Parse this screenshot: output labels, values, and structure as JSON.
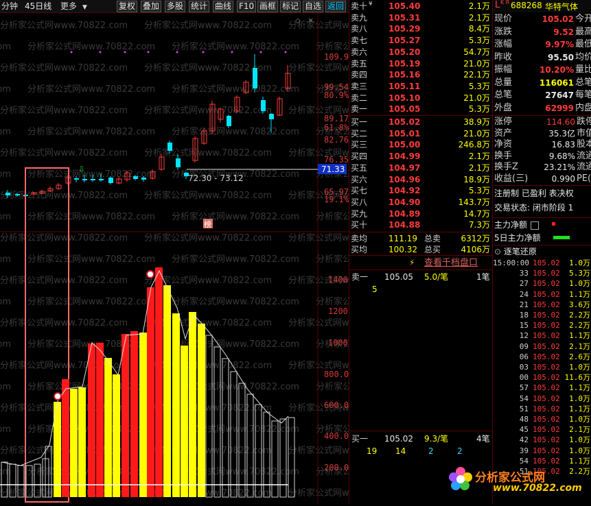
{
  "toolbar": {
    "period_left": "分钟",
    "period": "45日线",
    "more": "更多",
    "buttons": [
      "复权",
      "叠加",
      "多股",
      "统计",
      "曲线",
      "F10",
      "画框",
      "标记",
      "自选",
      "返回"
    ],
    "active": "返回"
  },
  "chart": {
    "price_axis": [
      "109.9",
      "99.54",
      "89.17",
      "82.76",
      "76.35",
      "65.97"
    ],
    "percent_axis": [
      "80.9%",
      "61.8%",
      "19.1%"
    ],
    "range_label": "72.30 - 73.12",
    "price_tag": "71.33",
    "volume_axis": [
      "1400",
      "1200",
      "1000",
      "800.0",
      "600.0",
      "400.0",
      "200.0"
    ],
    "marker_text": "榜",
    "watermark": "分析家公式网www.70822.com"
  },
  "stock": {
    "flag": "L",
    "flag_sup": "K R",
    "code": "688268",
    "name": "华特气体"
  },
  "ask": [
    {
      "label": "卖十",
      "price": "105.40",
      "vol": "2.1万"
    },
    {
      "label": "卖九",
      "price": "105.31",
      "vol": "2.1万"
    },
    {
      "label": "卖八",
      "price": "105.29",
      "vol": "8.4万"
    },
    {
      "label": "卖七",
      "price": "105.27",
      "vol": "5.3万"
    },
    {
      "label": "卖六",
      "price": "105.20",
      "vol": "54.7万"
    },
    {
      "label": "卖五",
      "price": "105.19",
      "vol": "21.0万"
    },
    {
      "label": "卖四",
      "price": "105.16",
      "vol": "22.1万"
    },
    {
      "label": "卖三",
      "price": "105.11",
      "vol": "5.3万"
    },
    {
      "label": "卖二",
      "price": "105.10",
      "vol": "21.0万"
    },
    {
      "label": "卖一",
      "price": "105.05",
      "vol": "5.3万"
    }
  ],
  "ask_sup": "¥",
  "bid": [
    {
      "label": "买一",
      "price": "105.02",
      "vol": "38.9万"
    },
    {
      "label": "买二",
      "price": "105.01",
      "vol": "21.0万"
    },
    {
      "label": "买三",
      "price": "105.00",
      "vol": "246.8万"
    },
    {
      "label": "买四",
      "price": "104.99",
      "vol": "2.1万"
    },
    {
      "label": "买五",
      "price": "104.97",
      "vol": "2.1万"
    },
    {
      "label": "买六",
      "price": "104.96",
      "vol": "18.9万"
    },
    {
      "label": "买七",
      "price": "104.92",
      "vol": "5.3万"
    },
    {
      "label": "买八",
      "price": "104.90",
      "vol": "143.7万"
    },
    {
      "label": "买九",
      "price": "104.89",
      "vol": "14.7万"
    },
    {
      "label": "买十",
      "price": "104.88",
      "vol": "7.3万"
    }
  ],
  "summary": [
    {
      "label": "卖均",
      "price": "111.19",
      "tag": "总卖",
      "vol": "6312万"
    },
    {
      "label": "买均",
      "price": "100.32",
      "tag": "总买",
      "vol": "4106万"
    }
  ],
  "quote": [
    {
      "k": "现价",
      "v": "105.02",
      "k2": "今开"
    },
    {
      "k": "涨跌",
      "v": "9.52",
      "k2": "最高"
    },
    {
      "k": "涨幅",
      "v": "9.97%",
      "k2": "最低"
    },
    {
      "k": "昨收",
      "v": "95.50",
      "k2": "均价"
    },
    {
      "k": "振幅",
      "v": "10.20%",
      "k2": "量比"
    },
    {
      "k": "总量",
      "v": "116061",
      "k2": "总笔"
    },
    {
      "k": "总笔",
      "v": "27647",
      "k2": "每笔"
    },
    {
      "k": "外盘",
      "v": "62999",
      "k2": "内盘"
    }
  ],
  "quote2": [
    {
      "k": "涨停",
      "v": "114.60",
      "k2": "跌停"
    },
    {
      "k": "资产",
      "v": "35.3亿",
      "k2": "市值"
    },
    {
      "k": "净资",
      "v": "16.83",
      "k2": "股本"
    },
    {
      "k": "换手",
      "v": "9.68%",
      "k2": "流通"
    },
    {
      "k": "换手Z",
      "v": "23.21%",
      "k2": "流通"
    },
    {
      "k": "收益(三)",
      "v": "0.990",
      "k2": "PE(动)"
    }
  ],
  "registration": "注册制 已盈利 表决权",
  "trade_status": "交易状态: 闭市阶段 1",
  "main_flow": "主力净额",
  "main_flow5": "5日主力净额",
  "tick_title": "逐笔还原",
  "depth_link": "查看千档盘口",
  "ask1": {
    "label": "卖一",
    "price": "105.05",
    "vol": "5.0/笔",
    "count": "1笔",
    "queue": [
      "5"
    ]
  },
  "bid1": {
    "label": "买一",
    "price": "105.02",
    "vol": "9.3/笔",
    "count": "4笔",
    "queue": [
      "19",
      "14",
      "2",
      "2"
    ]
  },
  "ticks": [
    {
      "t": "15:00:00",
      "p": "105.02",
      "v": "1.0万"
    },
    {
      "t": "33",
      "p": "105.02",
      "v": "5.3万"
    },
    {
      "t": "27",
      "p": "105.02",
      "v": "1.0万"
    },
    {
      "t": "24",
      "p": "105.02",
      "v": "1.1万"
    },
    {
      "t": "21",
      "p": "105.02",
      "v": "3.6万"
    },
    {
      "t": "18",
      "p": "105.02",
      "v": "2.2万"
    },
    {
      "t": "15",
      "p": "105.02",
      "v": "2.2万"
    },
    {
      "t": "12",
      "p": "105.02",
      "v": "1.1万"
    },
    {
      "t": "09",
      "p": "105.02",
      "v": "2.1万"
    },
    {
      "t": "06",
      "p": "105.02",
      "v": "2.6万"
    },
    {
      "t": "03",
      "p": "105.02",
      "v": "1.0万"
    },
    {
      "t": "00",
      "p": "105.02",
      "v": "11.6万"
    },
    {
      "t": "57",
      "p": "105.02",
      "v": "1.1万"
    },
    {
      "t": "54",
      "p": "105.02",
      "v": "1.0万"
    },
    {
      "t": "51",
      "p": "105.02",
      "v": "1.1万"
    },
    {
      "t": "48",
      "p": "105.02",
      "v": "1.0万"
    },
    {
      "t": "45",
      "p": "105.02",
      "v": "2.1万"
    },
    {
      "t": "42",
      "p": "105.02",
      "v": "1.0万"
    },
    {
      "t": "39",
      "p": "105.02",
      "v": "1.0万"
    },
    {
      "t": "54",
      "p": "105.02",
      "v": "1.1万"
    },
    {
      "t": "51",
      "p": "105.02",
      "v": "2.2万"
    }
  ],
  "brand": {
    "name": "分析家公式网",
    "url": "www.70822.com"
  },
  "colors": {
    "up": "#ff3b3b",
    "down": "#00e5ff",
    "yellow": "#ffff00",
    "accent": "#d43a3a"
  }
}
